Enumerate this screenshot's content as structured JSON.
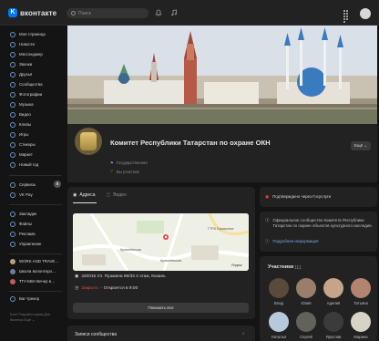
{
  "header": {
    "logo_text": "вконтакте",
    "search_placeholder": "Поиск"
  },
  "sidebar": {
    "items": [
      {
        "label": "Моя страница",
        "icon": "user-icon"
      },
      {
        "label": "Новости",
        "icon": "news-icon"
      },
      {
        "label": "Мессенджер",
        "icon": "message-icon"
      },
      {
        "label": "Звонки",
        "icon": "phone-icon"
      },
      {
        "label": "Друзья",
        "icon": "friends-icon"
      },
      {
        "label": "Сообщества",
        "icon": "groups-icon"
      },
      {
        "label": "Фотографии",
        "icon": "photo-icon"
      },
      {
        "label": "Музыка",
        "icon": "music-icon"
      },
      {
        "label": "Видео",
        "icon": "video-icon"
      },
      {
        "label": "Клипы",
        "icon": "clips-icon"
      },
      {
        "label": "Игры",
        "icon": "games-icon"
      },
      {
        "label": "Стикеры",
        "icon": "sticker-icon"
      },
      {
        "label": "Маркет",
        "icon": "market-icon"
      },
      {
        "label": "Новый год",
        "icon": "gift-icon"
      }
    ],
    "services": [
      {
        "label": "Сервисы",
        "icon": "services-icon",
        "badge": "8"
      },
      {
        "label": "VK Pay",
        "icon": "pay-icon"
      }
    ],
    "tools": [
      {
        "label": "Закладки",
        "icon": "bookmark-icon"
      },
      {
        "label": "Файлы",
        "icon": "file-icon"
      },
      {
        "label": "Реклама",
        "icon": "ads-icon"
      },
      {
        "label": "Управление",
        "icon": "manage-icon"
      }
    ],
    "groups": [
      {
        "label": "WORK AND TRAVE…"
      },
      {
        "label": "Школа волонтеро…"
      },
      {
        "label": "ТГУ-КВН Вечер в…"
      }
    ],
    "bugtracker": "Баг-трекер",
    "footer": "Блог   Разработчикам   Для бизнеса   Ещё ⌄"
  },
  "profile": {
    "name": "Комитет Республики Татарстан по охране ОКН",
    "meta_1": "Государственная",
    "meta_2": "Вы участник",
    "more_button": "Ещё"
  },
  "tabs": [
    {
      "label": "Адреса",
      "active": true
    },
    {
      "label": "Видео",
      "active": false
    }
  ],
  "map": {
    "label_1": "Кремлёвская",
    "label_2": "Кремлёвская",
    "label_3": "ГТРК Бумажные",
    "copyright": "Яндекс"
  },
  "address": {
    "line": "420015 Ул. Пушкина 66/33 4 этаж, Казань",
    "status_closed": "Закрыто",
    "status_open": "· Откроется в 9:00",
    "show_button": "Показать все"
  },
  "posts_card": {
    "title": "Записи сообщества"
  },
  "side_panel": {
    "verified": "Подтверждено через Госуслуги",
    "official": "Официальное сообщество Комитета Республики Татарстан по охране объектов культурного наследия.",
    "more_info": "Подробная информация"
  },
  "members": {
    "title": "Участники",
    "count": "111",
    "list": [
      {
        "name": "Влад",
        "color": "#5a4a3a"
      },
      {
        "name": "Юлия",
        "color": "#9a7d6a"
      },
      {
        "name": "Аделия",
        "color": "#c6a489"
      },
      {
        "name": "Татьяна",
        "color": "#b38470"
      },
      {
        "name": "Наталья",
        "color": "#b9c9dd"
      },
      {
        "name": "Сергей",
        "color": "#62625a"
      },
      {
        "name": "Ярослав",
        "color": "#3b3b3b"
      },
      {
        "name": "Марина",
        "color": "#d9d2c7"
      }
    ]
  },
  "colors": {
    "accent": "#0077ff",
    "link": "#71aaeb",
    "closed": "#e64646"
  }
}
